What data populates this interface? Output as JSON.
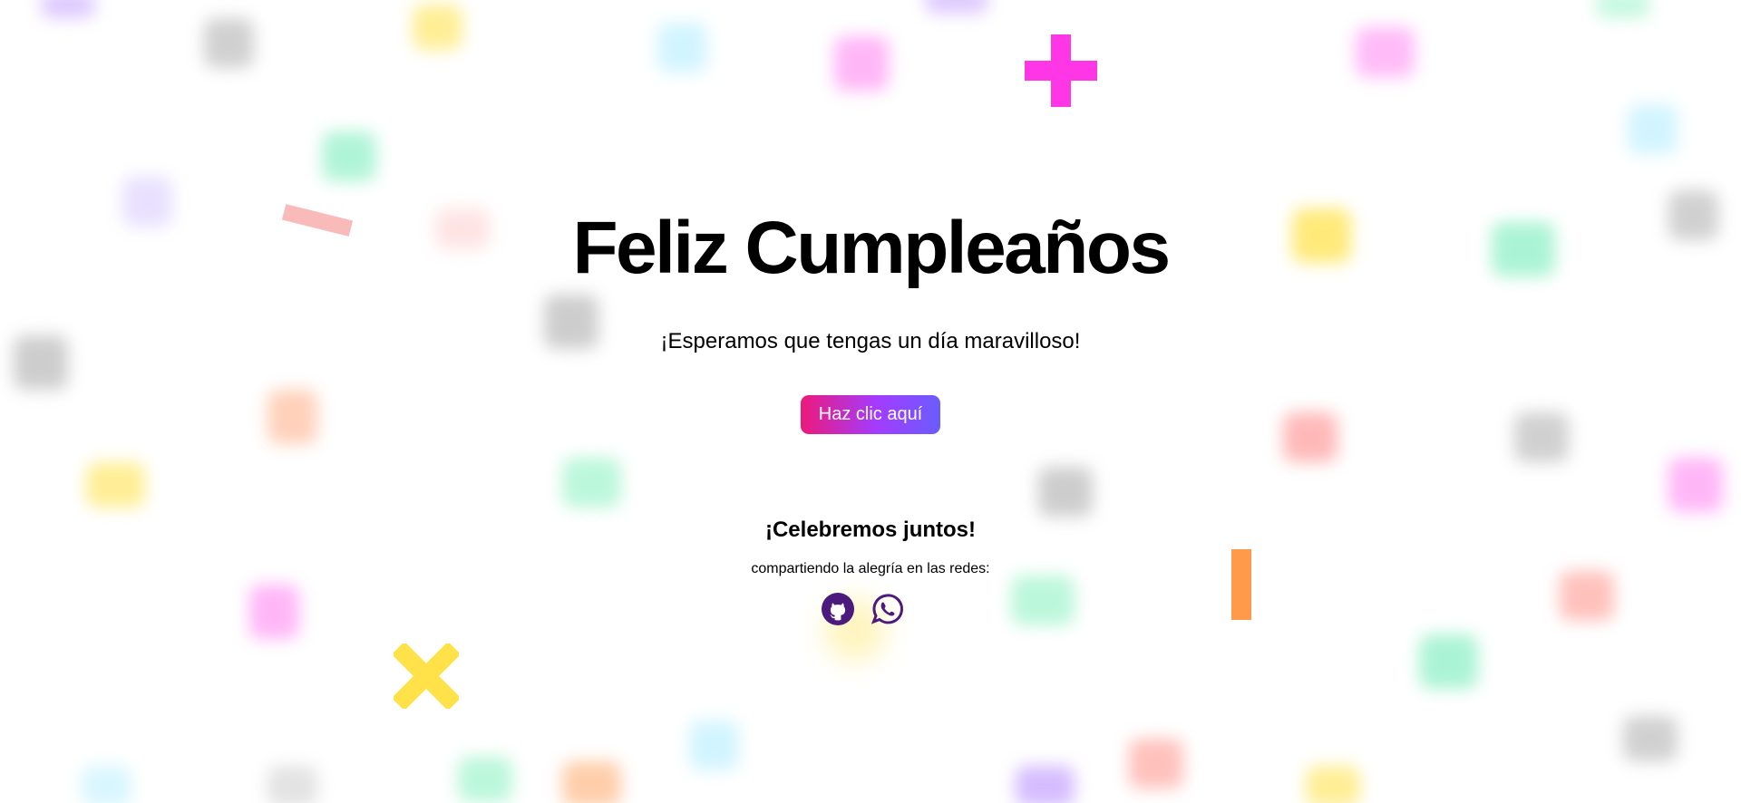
{
  "page": {
    "title": "Feliz Cumpleaños",
    "subtitle": "¡Esperamos que tengas un día maravilloso!",
    "cta_label": "Haz clic aquí",
    "celebrate_title": "¡Celebremos juntos!",
    "celebrate_text": "compartiendo la alegría en las redes:"
  },
  "social": [
    {
      "name": "github",
      "icon": "github-icon"
    },
    {
      "name": "whatsapp",
      "icon": "whatsapp-icon"
    }
  ],
  "colors": {
    "icon": "#4b1a7c",
    "cta_gradient": [
      "#ec1a7a",
      "#a23cff",
      "#6a5cff"
    ],
    "confetti": [
      "#ff36e6",
      "#ffe24a",
      "#ff9a4a",
      "#f7a7a7",
      "#7df0c2",
      "#bfe9ff",
      "#c8b4ff",
      "#c9c9c9",
      "#ff8b8b"
    ]
  }
}
